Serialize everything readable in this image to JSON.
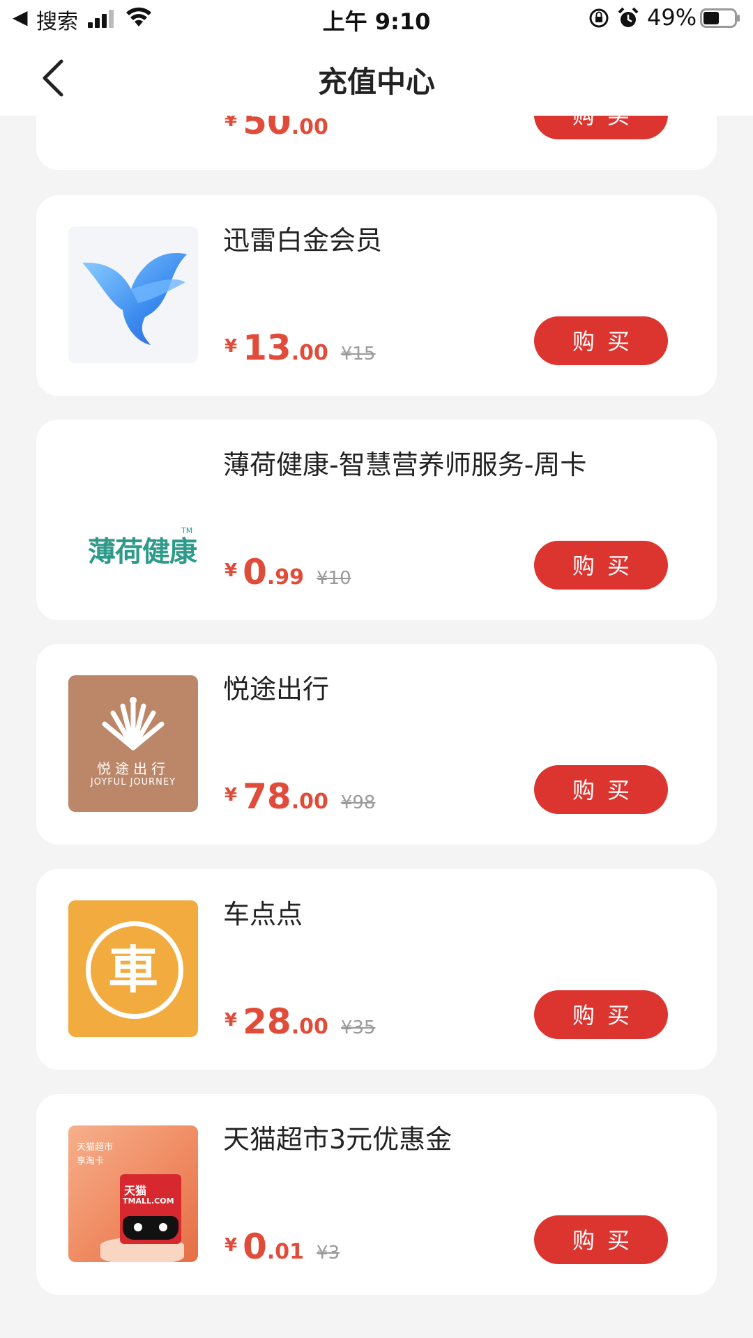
{
  "status_bar": {
    "back_label": "◀",
    "carrier": "搜索",
    "time": "上午 9:10",
    "battery": "49%"
  },
  "nav": {
    "title": "充值中心"
  },
  "buy_label": "购买",
  "top_card": {
    "price_int": "50",
    "price_dec": ".00"
  },
  "products": [
    {
      "name": "迅雷白金会员",
      "price_int": "13",
      "price_dec": ".00",
      "original": "¥15",
      "logo": "hummingbird-icon"
    },
    {
      "name": "薄荷健康-智慧营养师服务-周卡",
      "price_int": "0",
      "price_dec": ".99",
      "original": "¥10",
      "logo_text": "薄荷健康",
      "logo_tm": "TM"
    },
    {
      "name": "悦途出行",
      "price_int": "78",
      "price_dec": ".00",
      "original": "¥98",
      "logo_text": "悦途出行",
      "logo_sub": "JOYFUL JOURNEY"
    },
    {
      "name": "车点点",
      "price_int": "28",
      "price_dec": ".00",
      "original": "¥35",
      "logo_text": "車"
    },
    {
      "name": "天猫超市3元优惠金",
      "price_int": "0",
      "price_dec": ".01",
      "original": "¥3",
      "logo_text": "天猫超市",
      "logo_sub": "享淘卡",
      "logo_brand": "天猫",
      "logo_brand_en": "TMALL.COM"
    }
  ],
  "colors": {
    "accent": "#dc3530",
    "price": "#e14b39",
    "background": "#f4f4f5"
  }
}
